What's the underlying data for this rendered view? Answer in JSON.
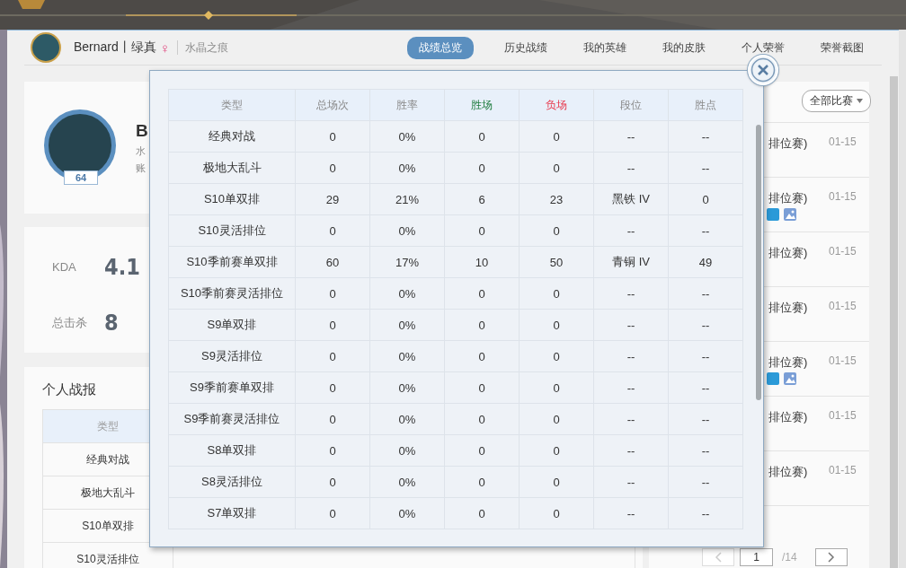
{
  "header": {
    "name": "Bernard丨绿真",
    "gender": "♀",
    "server": "水晶之痕"
  },
  "nav_tabs": [
    {
      "label": "战绩总览",
      "selected": true
    },
    {
      "label": "历史战绩",
      "selected": false
    },
    {
      "label": "我的英雄",
      "selected": false
    },
    {
      "label": "我的皮肤",
      "selected": false
    },
    {
      "label": "个人荣誉",
      "selected": false
    },
    {
      "label": "荣誉截图",
      "selected": false
    }
  ],
  "profile": {
    "level": "64",
    "name": "B",
    "line_1": "水",
    "line_2": "账"
  },
  "stats": [
    {
      "label": "KDA",
      "value": "4.1"
    },
    {
      "label": "总击杀",
      "value": "8"
    }
  ],
  "report": {
    "title": "个人战报",
    "column_1": "类型",
    "rows": [
      "经典对战",
      "极地大乱斗",
      "S10单双排",
      "S10灵活排位"
    ]
  },
  "match_list": {
    "filter": "全部比赛",
    "rows": [
      {
        "mode": "排位赛)",
        "date": "01-15",
        "has_icons": false
      },
      {
        "mode": "排位赛)",
        "date": "01-15",
        "has_icons": true
      },
      {
        "mode": "排位赛)",
        "date": "01-15",
        "has_icons": false
      },
      {
        "mode": "排位赛)",
        "date": "01-15",
        "has_icons": false
      },
      {
        "mode": "排位赛)",
        "date": "01-15",
        "has_icons": true
      },
      {
        "mode": "排位赛)",
        "date": "01-15",
        "has_icons": false
      },
      {
        "mode": "排位赛)",
        "date": "01-15",
        "has_icons": false
      }
    ],
    "pagination": {
      "page": "1",
      "total": "/14"
    }
  },
  "modal": {
    "columns": [
      {
        "label": "类型",
        "color": "#888888"
      },
      {
        "label": "总场次",
        "color": "#888888"
      },
      {
        "label": "胜率",
        "color": "#888888"
      },
      {
        "label": "胜场",
        "color": "#1a7a3a"
      },
      {
        "label": "负场",
        "color": "#e8364a"
      },
      {
        "label": "段位",
        "color": "#888888"
      },
      {
        "label": "胜点",
        "color": "#888888"
      }
    ],
    "rows": [
      [
        "经典对战",
        "0",
        "0%",
        "0",
        "0",
        "--",
        "--"
      ],
      [
        "极地大乱斗",
        "0",
        "0%",
        "0",
        "0",
        "--",
        "--"
      ],
      [
        "S10单双排",
        "29",
        "21%",
        "6",
        "23",
        "黑铁 IV",
        "0"
      ],
      [
        "S10灵活排位",
        "0",
        "0%",
        "0",
        "0",
        "--",
        "--"
      ],
      [
        "S10季前赛单双排",
        "60",
        "17%",
        "10",
        "50",
        "青铜 IV",
        "49"
      ],
      [
        "S10季前赛灵活排位",
        "0",
        "0%",
        "0",
        "0",
        "--",
        "--"
      ],
      [
        "S9单双排",
        "0",
        "0%",
        "0",
        "0",
        "--",
        "--"
      ],
      [
        "S9灵活排位",
        "0",
        "0%",
        "0",
        "0",
        "--",
        "--"
      ],
      [
        "S9季前赛单双排",
        "0",
        "0%",
        "0",
        "0",
        "--",
        "--"
      ],
      [
        "S9季前赛灵活排位",
        "0",
        "0%",
        "0",
        "0",
        "--",
        "--"
      ],
      [
        "S8单双排",
        "0",
        "0%",
        "0",
        "0",
        "--",
        "--"
      ],
      [
        "S8灵活排位",
        "0",
        "0%",
        "0",
        "0",
        "--",
        "--"
      ],
      [
        "S7单双排",
        "0",
        "0%",
        "0",
        "0",
        "--",
        "--"
      ]
    ]
  }
}
